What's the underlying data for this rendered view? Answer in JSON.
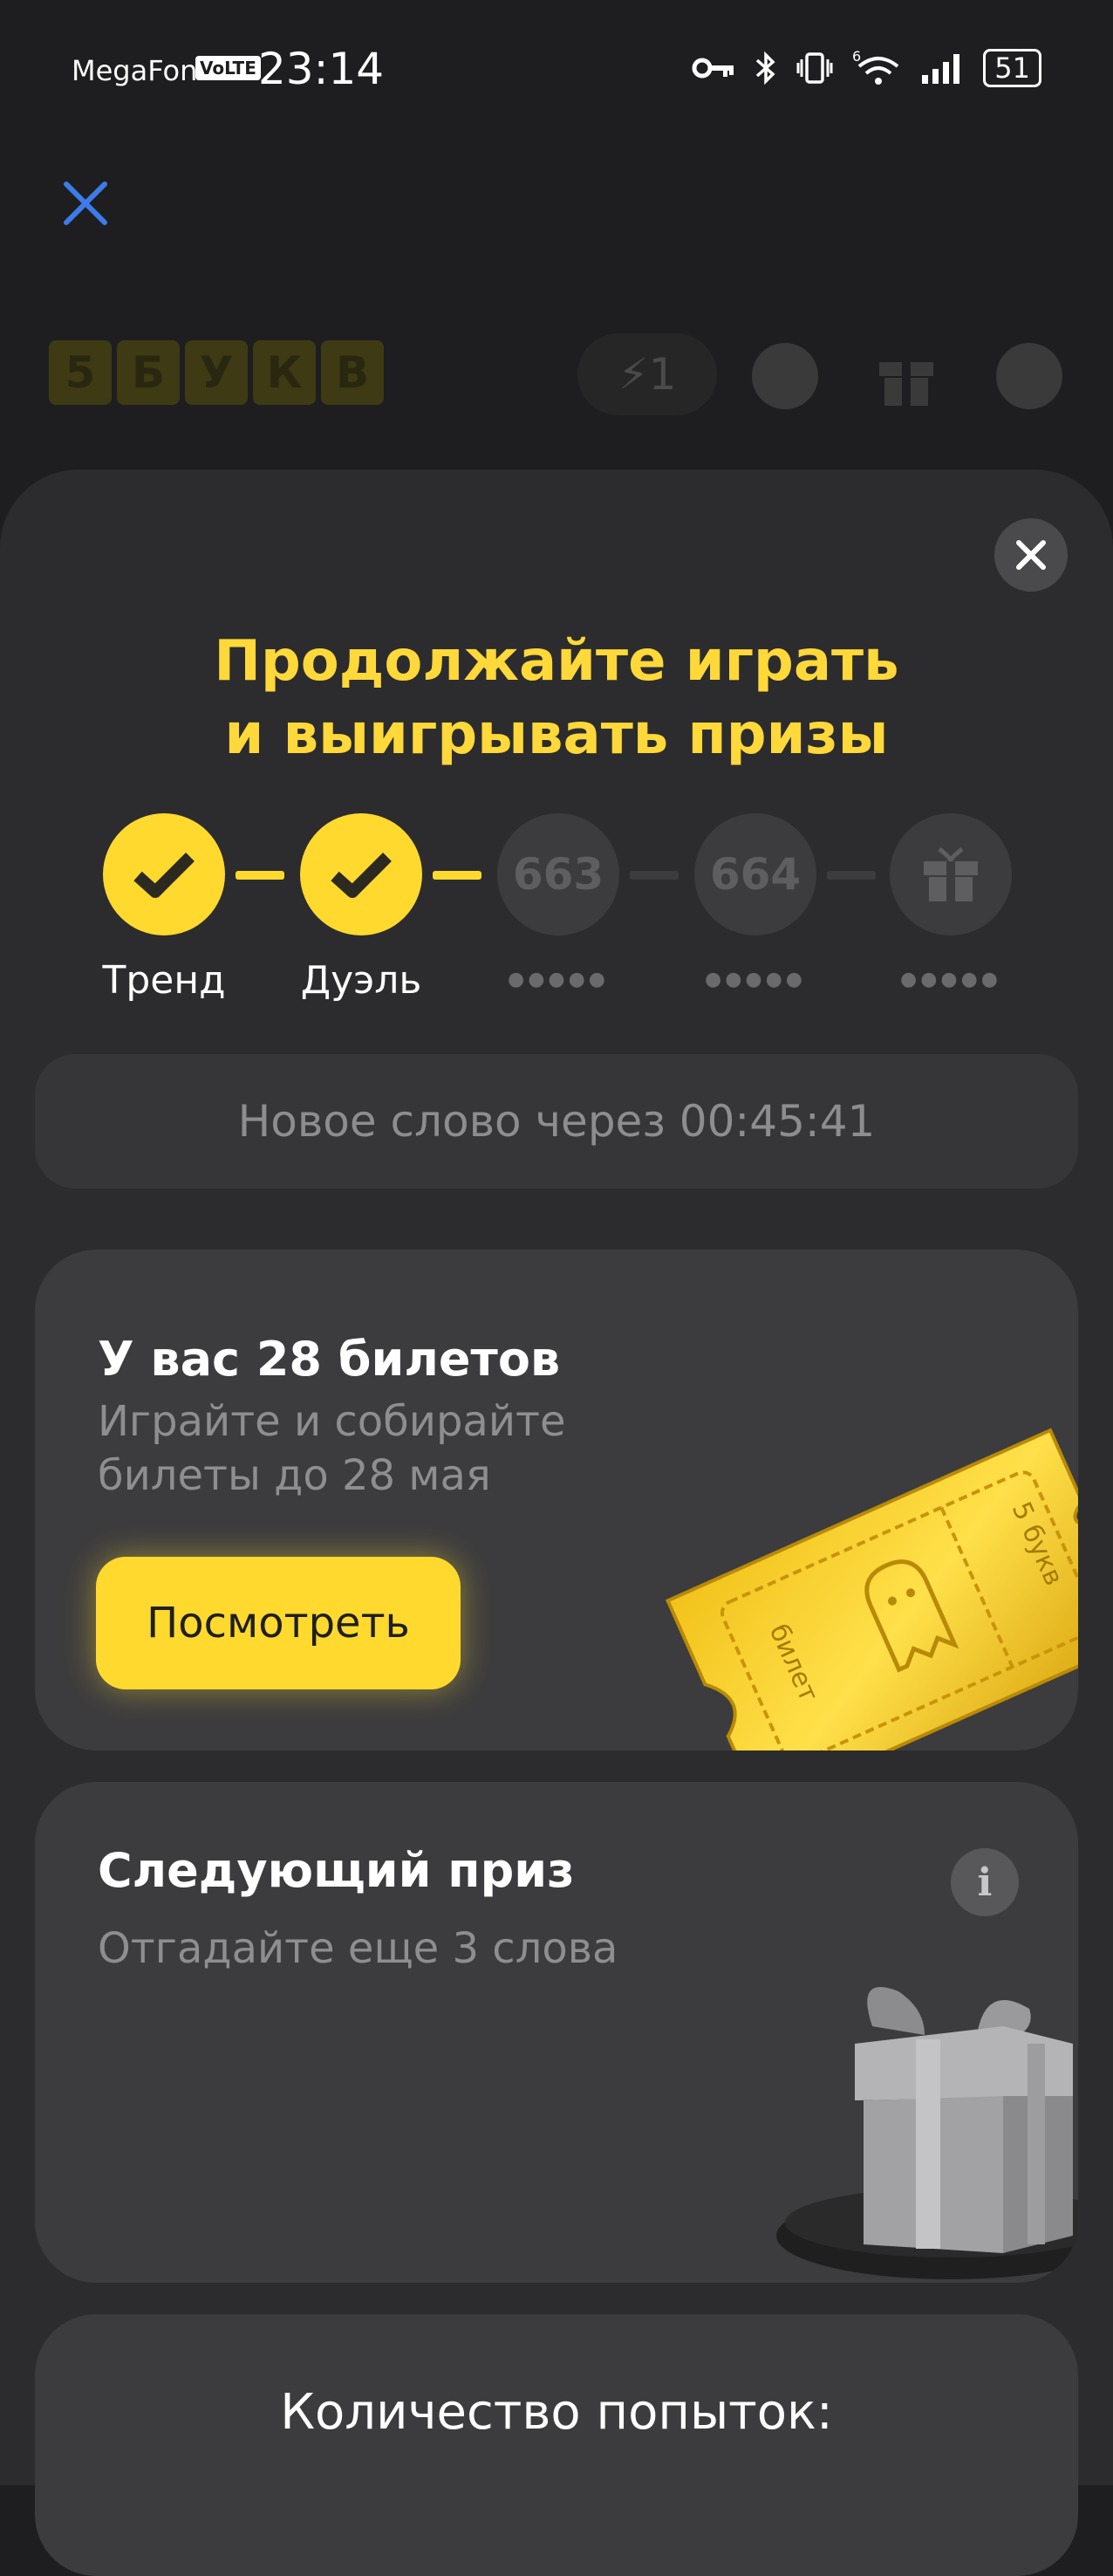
{
  "status_bar": {
    "carrier": "MegaFon",
    "volte": "VoLTE",
    "time": "23:14",
    "battery": "51"
  },
  "background_game": {
    "logo_letters": [
      "5",
      "Б",
      "У",
      "К",
      "В"
    ],
    "energy": "1"
  },
  "sheet": {
    "headline_line1": "Продолжайте играть",
    "headline_line2": "и выигрывать призы",
    "steps": [
      {
        "label": "Тренд",
        "state": "done"
      },
      {
        "label": "Дуэль",
        "state": "done"
      },
      {
        "number": "663",
        "state": "locked",
        "dots": "●●●●●"
      },
      {
        "number": "664",
        "state": "locked",
        "dots": "●●●●●"
      },
      {
        "icon": "gift-icon",
        "state": "locked",
        "dots": "●●●●●"
      }
    ],
    "timer_text": "Новое слово через 00:45:41"
  },
  "tickets_card": {
    "title": "У вас 28 билетов",
    "subtitle_line1": "Играйте и собирайте",
    "subtitle_line2": "билеты до 28 мая",
    "button_label": "Посмотреть",
    "ticket_text_left": "билет",
    "ticket_text_right": "5 букв"
  },
  "prize_card": {
    "title": "Следующий приз",
    "subtitle": "Отгадайте еще 3 слова",
    "info_icon": "i"
  },
  "attempts_card": {
    "title": "Количество попыток:"
  },
  "colors": {
    "accent": "#ffd92e",
    "headline": "#ffd83a",
    "background": "#1e1e20",
    "sheet": "#2c2c2e",
    "card": "#3c3c3e",
    "close_x": "#3d7be8"
  }
}
